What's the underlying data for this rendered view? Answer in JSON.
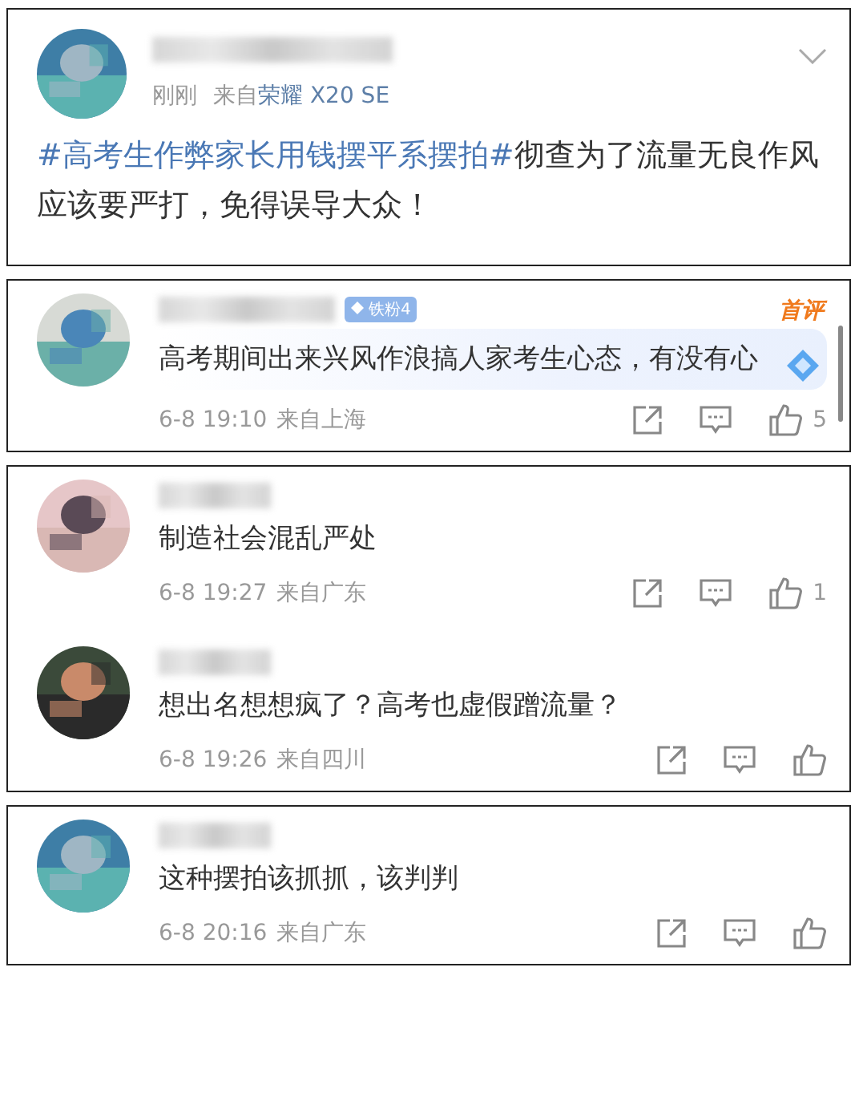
{
  "post": {
    "time": "刚刚",
    "source_prefix": "来自",
    "device": "荣耀 X20 SE",
    "hashtag": "#高考生作弊家长用钱摆平系摆拍#",
    "text": "彻查为了流量无良作风应该要严打，免得误导大众！"
  },
  "comment_groups": [
    {
      "comments": [
        {
          "badge": "铁粉4",
          "label": "首评",
          "highlighted": true,
          "text": "高考期间出来兴风作浪搞人家考生心态，有没有心",
          "time": "6-8 19:10",
          "location": "来自上海",
          "likes": "5"
        }
      ]
    },
    {
      "comments": [
        {
          "highlighted": false,
          "text": "制造社会混乱严处",
          "time": "6-8 19:27",
          "location": "来自广东",
          "likes": "1"
        },
        {
          "highlighted": false,
          "text": "想出名想想疯了？高考也虚假蹭流量？",
          "time": "6-8 19:26",
          "location": "来自四川"
        }
      ]
    },
    {
      "comments": [
        {
          "highlighted": false,
          "text": "这种摆拍该抓抓，该判判",
          "time": "6-8 20:16",
          "location": "来自广东"
        }
      ]
    }
  ]
}
